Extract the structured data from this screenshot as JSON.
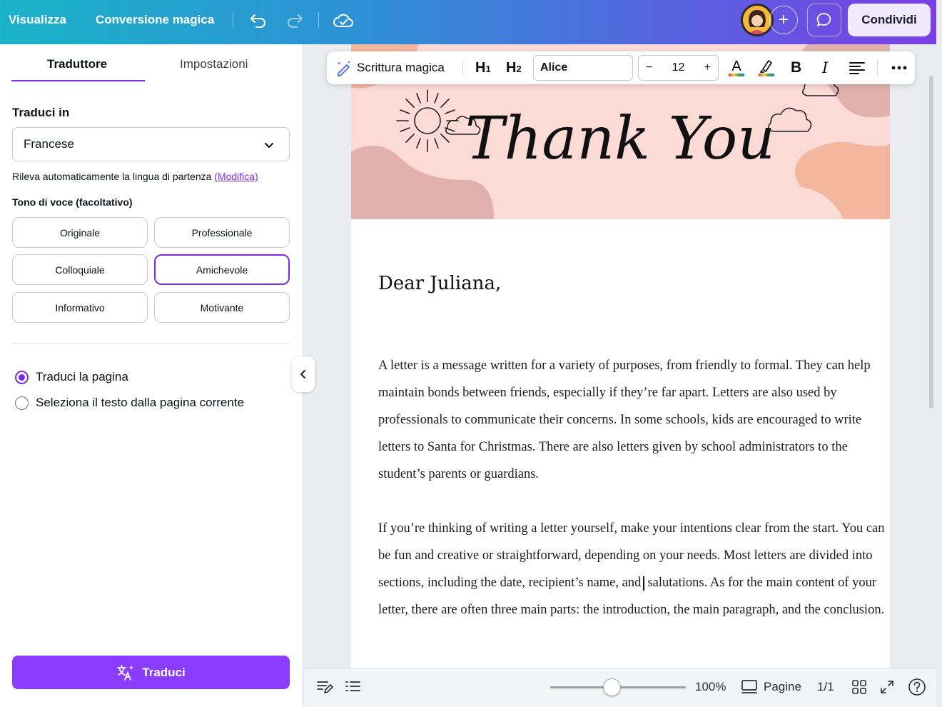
{
  "topbar": {
    "view_label": "Visualizza",
    "magic_switch_label": "Conversione magica",
    "share_label": "Condividi",
    "undo_icon": "undo-icon",
    "redo_icon": "redo-icon",
    "cloud_icon": "cloud-check-icon"
  },
  "panel": {
    "tabs": [
      {
        "label": "Traduttore",
        "active": true
      },
      {
        "label": "Impostazioni",
        "active": false
      }
    ],
    "translate_to_title": "Traduci in",
    "language_value": "Francese",
    "detect_text": "Rileva automaticamente la lingua di partenza",
    "detect_link": "(Modifica)",
    "tone_title": "Tono di voce (facoltativo)",
    "tones": [
      "Originale",
      "Professionale",
      "Colloquiale",
      "Amichevole",
      "Informativo",
      "Motivante"
    ],
    "selected_tone": "Amichevole",
    "scope_options": [
      {
        "label": "Traduci la pagina",
        "selected": true
      },
      {
        "label": "Seleziona il testo dalla pagina corrente",
        "selected": false
      }
    ],
    "translate_button": "Traduci"
  },
  "toolbar": {
    "magic_write": "Scrittura magica",
    "h1": "H1",
    "h2": "H2",
    "font": "Alice",
    "font_size": "12",
    "minus": "−",
    "plus": "+"
  },
  "document": {
    "banner_text": "Thank You",
    "greeting": "Dear Juliana,",
    "paragraph1": "A letter is a message written for a variety of purposes, from friendly to formal. They can help maintain bonds between friends, especially if they’re far apart. Letters are also used by professionals to communicate their concerns. In some schools, kids are encouraged to write letters to Santa for Christmas. There are also letters given by school administrators to the student’s parents or guardians.",
    "paragraph2": "If you’re thinking of writing a letter yourself, make your intentions clear from the start. You can be fun and creative or straightforward, depending on your needs. Most letters are divided into sections, including the date, recipient’s name, and salutations. As for the main content of your letter, there are often three main parts: the introduction, the main paragraph, and the conclusion."
  },
  "bottombar": {
    "zoom": "100%",
    "zoom_fraction": 0.45,
    "pages_label": "Pagine",
    "page_count": "1/1"
  },
  "colors": {
    "accent": "#7d2ae8",
    "button": "#8b3dff",
    "banner": "#fcdad5"
  }
}
